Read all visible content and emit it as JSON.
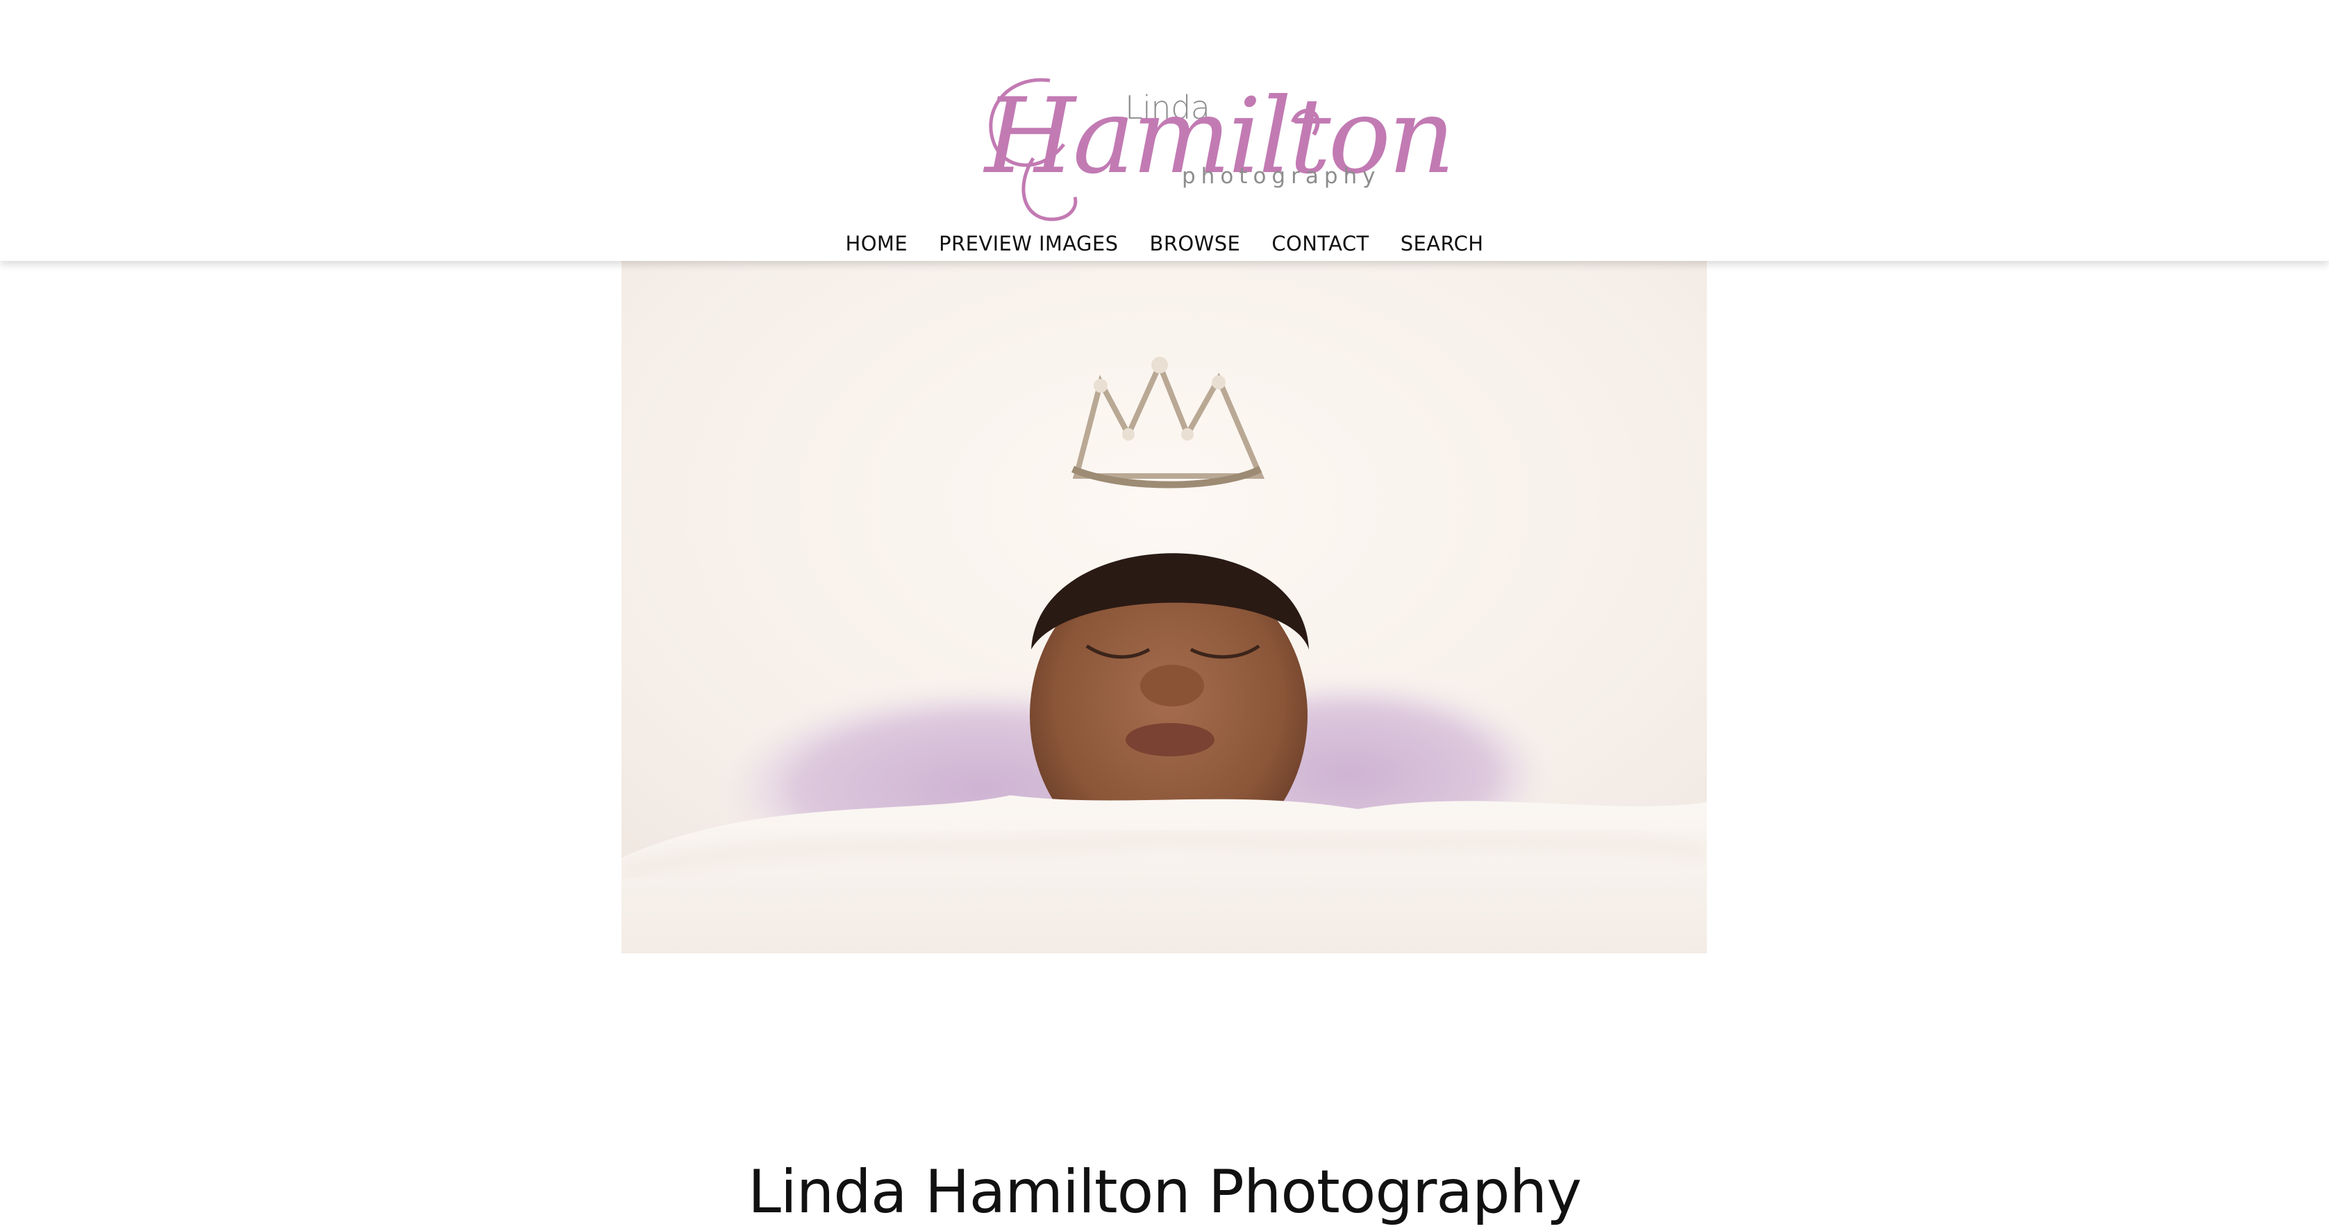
{
  "brand": {
    "logo_first": "Linda",
    "logo_main": "Hamilton",
    "logo_sub": "photography",
    "accent_color": "#c27ab3",
    "logo_gray": "#8d8d8d"
  },
  "nav": {
    "items": [
      {
        "label": "HOME"
      },
      {
        "label": "PREVIEW IMAGES"
      },
      {
        "label": "BROWSE"
      },
      {
        "label": "CONTACT"
      },
      {
        "label": "SEARCH"
      }
    ]
  },
  "hero": {
    "image_alt": "sleeping newborn baby wearing a rhinestone crown on a fluffy white blanket with lavender wrap"
  },
  "main": {
    "title": "Linda Hamilton Photography"
  }
}
